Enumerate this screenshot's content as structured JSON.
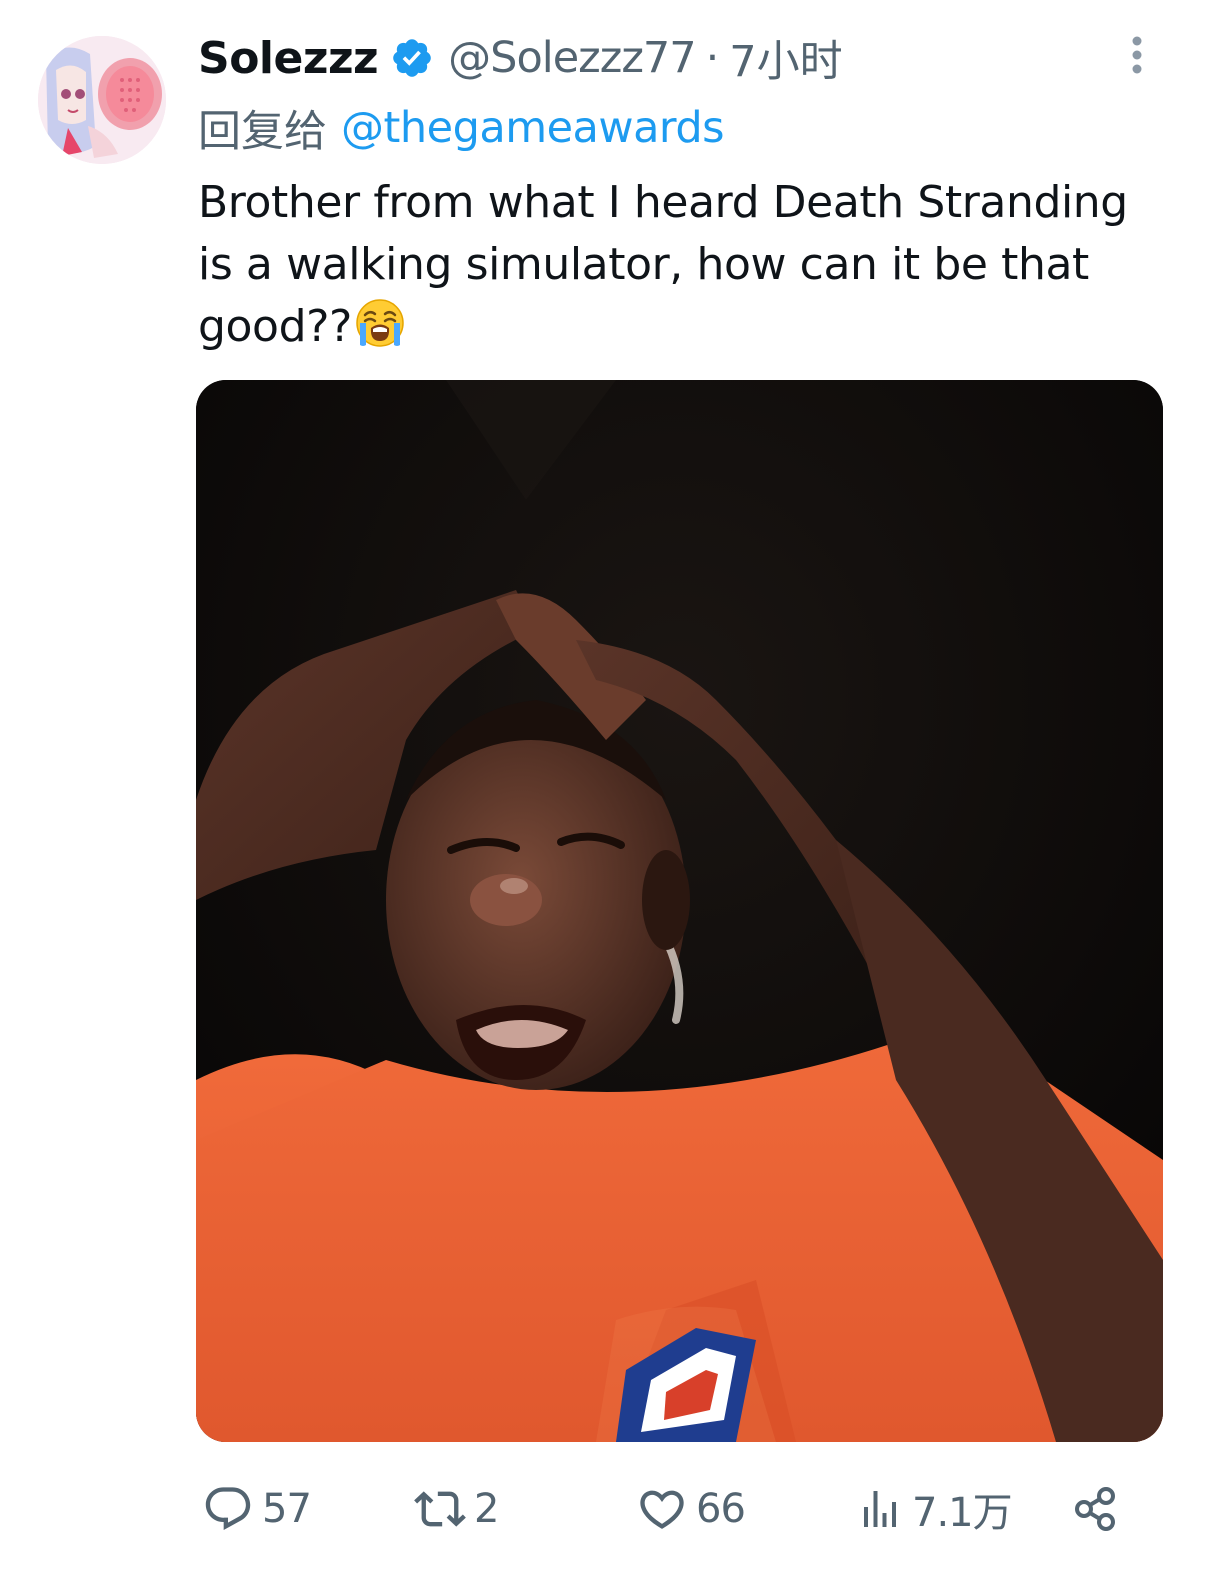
{
  "tweet": {
    "author": {
      "display_name": "Solezzz",
      "verified": true,
      "handle": "@Solezzz77",
      "separator": "·",
      "time": "7小时"
    },
    "reply": {
      "prefix": "回复给",
      "target": "@thegameawards"
    },
    "text": "Brother from what I heard Death Stranding is a walking simulator, how can it be that good??",
    "text_emoji": "loudly-crying-face",
    "media": {
      "type": "photo"
    },
    "actions": {
      "replies": "57",
      "retweets": "2",
      "likes": "66",
      "views": "7.1万"
    }
  },
  "colors": {
    "text": "#0f1419",
    "secondary": "#536471",
    "accent": "#1d9bf0"
  },
  "icons": {
    "verified": "verified-badge-icon",
    "more": "more-vertical-icon",
    "reply": "reply-bubble-icon",
    "retweet": "retweet-icon",
    "like": "heart-icon",
    "views": "views-bar-icon",
    "share": "share-icon"
  }
}
